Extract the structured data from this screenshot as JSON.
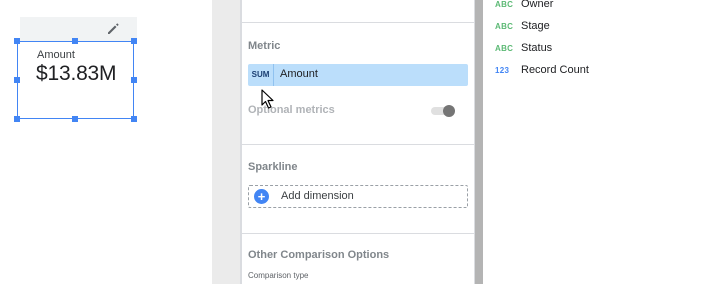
{
  "scorecard": {
    "label": "Amount",
    "value": "$13.83M"
  },
  "panel": {
    "metric_title": "Metric",
    "metric_chip": {
      "aggregation": "SUM",
      "label": "Amount"
    },
    "optional_metrics_label": "Optional metrics",
    "optional_metrics_enabled": false,
    "sparkline_title": "Sparkline",
    "add_dimension_label": "Add dimension",
    "other_options_title": "Other Comparison Options",
    "comparison_type_label": "Comparison type"
  },
  "fields": [
    {
      "type": "ABC",
      "kind": "dimension",
      "name": "Owner"
    },
    {
      "type": "ABC",
      "kind": "dimension",
      "name": "Stage"
    },
    {
      "type": "ABC",
      "kind": "dimension",
      "name": "Status"
    },
    {
      "type": "123",
      "kind": "metric",
      "name": "Record Count"
    }
  ],
  "colors": {
    "selection": "#4285f4",
    "metric_chip": "#bbdefb",
    "dimension_type": "#5bb974",
    "metric_type": "#4285f4"
  }
}
